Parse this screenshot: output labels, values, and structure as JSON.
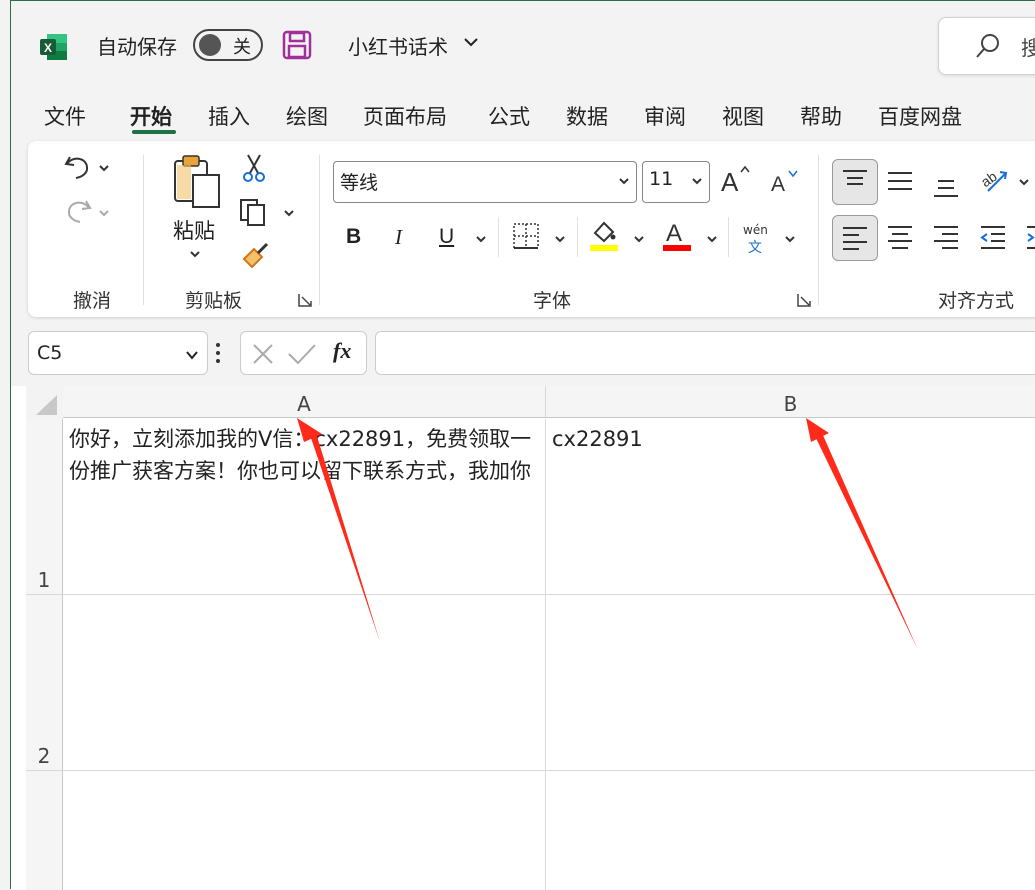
{
  "title_bar": {
    "autosave_label": "自动保存",
    "autosave_state": "关",
    "document_name": "小红书话术",
    "search_text": "搜"
  },
  "tabs": [
    {
      "label": "文件"
    },
    {
      "label": "开始"
    },
    {
      "label": "插入"
    },
    {
      "label": "绘图"
    },
    {
      "label": "页面布局"
    },
    {
      "label": "公式"
    },
    {
      "label": "数据"
    },
    {
      "label": "审阅"
    },
    {
      "label": "视图"
    },
    {
      "label": "帮助"
    },
    {
      "label": "百度网盘"
    }
  ],
  "ribbon": {
    "groups": {
      "undo": "撤消",
      "clipboard": "剪贴板",
      "font": "字体",
      "alignment": "对齐方式"
    },
    "paste_label": "粘贴",
    "font_name": "等线",
    "font_size": "11",
    "bold": "B",
    "italic": "I",
    "underline": "U",
    "phonetic_top": "wén",
    "phonetic_bottom": "文",
    "fill_color": "#ffff00",
    "font_color": "#ff0000"
  },
  "formula_bar": {
    "name_box": "C5",
    "fx_label": "fx",
    "formula": ""
  },
  "sheet": {
    "columns": [
      "A",
      "B"
    ],
    "rows": [
      "1",
      "2"
    ],
    "cells": {
      "A1": "你好，立刻添加我的V信：cx22891，免费领取一份推广获客方案！你也可以留下联系方式，我加你",
      "B1": "cx22891"
    }
  },
  "colors": {
    "excel_green": "#1e7145",
    "arrow": "#ff2a1a"
  }
}
